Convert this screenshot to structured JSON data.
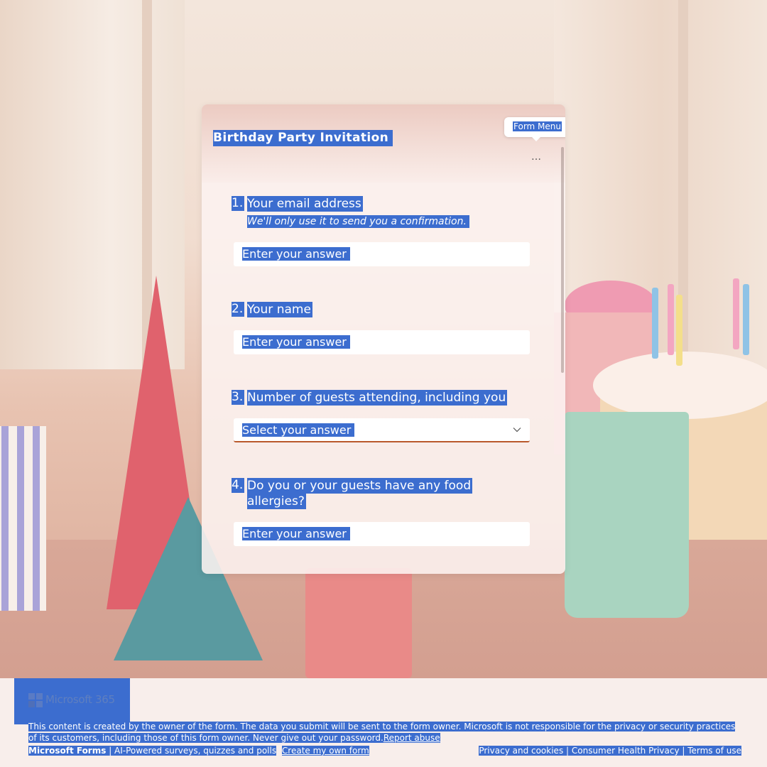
{
  "form": {
    "title": "Birthday Party Invitation",
    "menu_tooltip": "Form Menu",
    "more_icon": "…"
  },
  "questions": [
    {
      "number": "1.",
      "title": "Your email address",
      "subtitle": "We'll only use it to send you a confirmation.",
      "placeholder": "Enter your answer",
      "type": "text"
    },
    {
      "number": "2.",
      "title": "Your name",
      "placeholder": "Enter your answer",
      "type": "text"
    },
    {
      "number": "3.",
      "title": "Number of guests attending, including you",
      "placeholder": "Select your answer",
      "type": "dropdown"
    },
    {
      "number": "4.",
      "title_line1": "Do you or your guests have any food",
      "title_line2": "allergies?",
      "placeholder": "Enter your answer",
      "type": "text"
    }
  ],
  "footer": {
    "brand": "Microsoft 365",
    "disclaimer_line1": "This content is created by the owner of the form. The data you submit will be sent to the form owner. Microsoft is not responsible for the privacy or security practices",
    "disclaimer_line2": "of its customers, including those of this form owner. Never give out your password.",
    "report_abuse": "Report abuse",
    "forms_name": "Microsoft Forms",
    "forms_tagline": " | AI-Powered surveys, quizzes and polls",
    "create_form": "Create my own form",
    "privacy": "Privacy and cookies",
    "sep": " | ",
    "health_privacy": "Consumer Health Privacy",
    "terms": "Terms of use"
  },
  "colors": {
    "highlight": "#3c6dcf",
    "accent_underline": "#b9582b",
    "ms_red": "#f25022",
    "ms_green": "#7fba00",
    "ms_blue": "#00a4ef",
    "ms_yellow": "#ffb900"
  }
}
